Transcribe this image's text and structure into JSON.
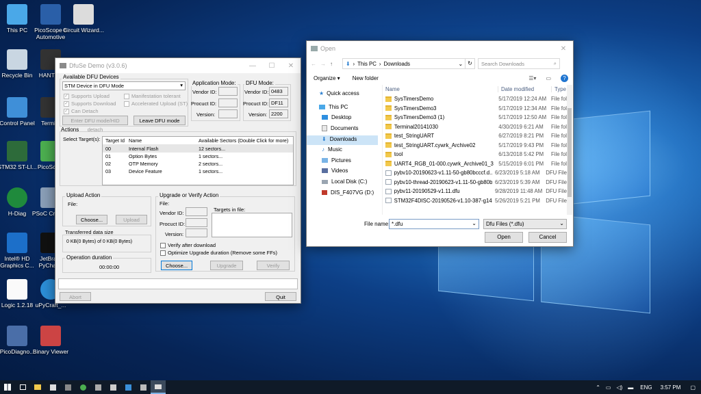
{
  "desktop": {
    "icons": [
      {
        "label": "This PC"
      },
      {
        "label": "PicoScope 6 Automotive"
      },
      {
        "label": "Circuit Wizard..."
      },
      {
        "label": "Recycle Bin"
      },
      {
        "label": "HANTEK"
      },
      {
        "label": "Control Panel"
      },
      {
        "label": "Termi..."
      },
      {
        "label": "STM32 ST-LI..."
      },
      {
        "label": "PicoSco..."
      },
      {
        "label": "H-Diag"
      },
      {
        "label": "PSoC Cr... 4.2"
      },
      {
        "label": "Intel® HD Graphics C..."
      },
      {
        "label": "JetBra... PyChar..."
      },
      {
        "label": "Logic 1.2.18"
      },
      {
        "label": "uPyCraft_..."
      },
      {
        "label": "PicoDiagno..."
      },
      {
        "label": "Binary Viewer"
      }
    ]
  },
  "dfuse": {
    "title": "DfuSe Demo (v3.0.6)",
    "available_devices_label": "Available DFU Devices",
    "device_selected": "STM Device in DFU Mode",
    "checks": {
      "supports_upload": "Supports Upload",
      "supports_download": "Supports Download",
      "can_detach": "Can Detach",
      "manifestation": "Manifestation tolerant",
      "accelerated": "Accelerated Upload (ST)"
    },
    "enter_dfu_label": "Enter DFU mode/HID detach",
    "leave_dfu_label": "Leave DFU mode",
    "app_mode_label": "Application Mode:",
    "dfu_mode_label": "DFU Mode:",
    "vendor_id_label": "Vendor ID:",
    "procuct_id_label": "Procuct ID:",
    "version_label": "Version:",
    "dfu_vendor_id": "0483",
    "dfu_procuct_id": "DF11",
    "dfu_version": "2200",
    "actions_label": "Actions",
    "select_targets_label": "Select Target(s):",
    "targets_columns": [
      "Target Id",
      "Name",
      "Available Sectors (Double Click for more)"
    ],
    "targets_rows": [
      {
        "id": "00",
        "name": "Internal Flash",
        "sectors": "12 sectors..."
      },
      {
        "id": "01",
        "name": "Option Bytes",
        "sectors": "1 sectors..."
      },
      {
        "id": "02",
        "name": "OTP Memory",
        "sectors": "2 sectors..."
      },
      {
        "id": "03",
        "name": "Device Feature",
        "sectors": "1 sectors..."
      }
    ],
    "upload_action_label": "Upload Action",
    "file_label": "File:",
    "choose_label": "Choose...",
    "upload_label": "Upload",
    "transferred_label": "Transferred data size",
    "transferred_value": "0 KB(0 Bytes) of 0 KB(0 Bytes)",
    "operation_duration_label": "Operation duration",
    "operation_duration_value": "00:00:00",
    "upgrade_label": "Upgrade or Verify Action",
    "targets_in_file_label": "Targets in file:",
    "verify_after_label": "Verify after download",
    "optimize_label": "Optimize Upgrade duration (Remove some FFs)",
    "upgrade_btn_label": "Upgrade",
    "verify_btn_label": "Verify",
    "abort_label": "Abort",
    "quit_label": "Quit"
  },
  "open_dialog": {
    "title": "Open",
    "path": [
      "This PC",
      "Downloads"
    ],
    "search_placeholder": "Search Downloads",
    "organize_label": "Organize ▾",
    "new_folder_label": "New folder",
    "nav": [
      {
        "label": "Quick access",
        "icon": "star-icon"
      },
      {
        "label": "This PC",
        "icon": "pc-icon"
      },
      {
        "label": "Desktop",
        "icon": "desktop-icon"
      },
      {
        "label": "Documents",
        "icon": "documents-icon"
      },
      {
        "label": "Downloads",
        "icon": "downloads-icon"
      },
      {
        "label": "Music",
        "icon": "music-icon"
      },
      {
        "label": "Pictures",
        "icon": "pictures-icon"
      },
      {
        "label": "Videos",
        "icon": "videos-icon"
      },
      {
        "label": "Local Disk (C:)",
        "icon": "disk-icon"
      },
      {
        "label": "DIS_F407VG (D:)",
        "icon": "usb-drive-icon"
      }
    ],
    "columns": [
      "Name",
      "Date modified",
      "Type"
    ],
    "files": [
      {
        "name": "SysTimersDemo",
        "date": "5/17/2019 12:24 AM",
        "type": "File fol",
        "kind": "folder"
      },
      {
        "name": "SysTimersDemo3",
        "date": "5/17/2019 12:34 AM",
        "type": "File fol",
        "kind": "folder"
      },
      {
        "name": "SysTimersDemo3 (1)",
        "date": "5/17/2019 12:50 AM",
        "type": "File fol",
        "kind": "folder"
      },
      {
        "name": "Terminal20141030",
        "date": "4/30/2019 6:21 AM",
        "type": "File fol",
        "kind": "folder"
      },
      {
        "name": "test_StringUART",
        "date": "6/27/2019 8:21 PM",
        "type": "File fol",
        "kind": "folder"
      },
      {
        "name": "test_StringUART.cywrk_Archive02",
        "date": "5/17/2019 9:43 PM",
        "type": "File fol",
        "kind": "folder"
      },
      {
        "name": "tool",
        "date": "6/13/2018 5:42 PM",
        "type": "File fol",
        "kind": "folder"
      },
      {
        "name": "UART4_RGB_01-000.cywrk_Archive01_3",
        "date": "5/15/2019 6:01 PM",
        "type": "File fol",
        "kind": "folder"
      },
      {
        "name": "pybv10-20190623-v1.11-50-gb80bcccf.d...",
        "date": "6/23/2019 5:18 AM",
        "type": "DFU File",
        "kind": "file"
      },
      {
        "name": "pybv10-thread-20190623-v1.11-50-gb80b...",
        "date": "6/23/2019 5:39 AM",
        "type": "DFU File",
        "kind": "file"
      },
      {
        "name": "pybv11-20190529-v1.11.dfu",
        "date": "9/28/2019 11:48 AM",
        "type": "DFU File",
        "kind": "file"
      },
      {
        "name": "STM32F4DISC-20190526-v1.10-387-g1470...",
        "date": "5/26/2019 5:21 PM",
        "type": "DFU File",
        "kind": "file"
      }
    ],
    "filename_label": "File name:",
    "filename_value": "*.dfu",
    "filter_value": "Dfu Files (*.dfu)",
    "open_label": "Open",
    "cancel_label": "Cancel"
  },
  "taskbar": {
    "lang": "ENG",
    "time": "3:57 PM"
  }
}
